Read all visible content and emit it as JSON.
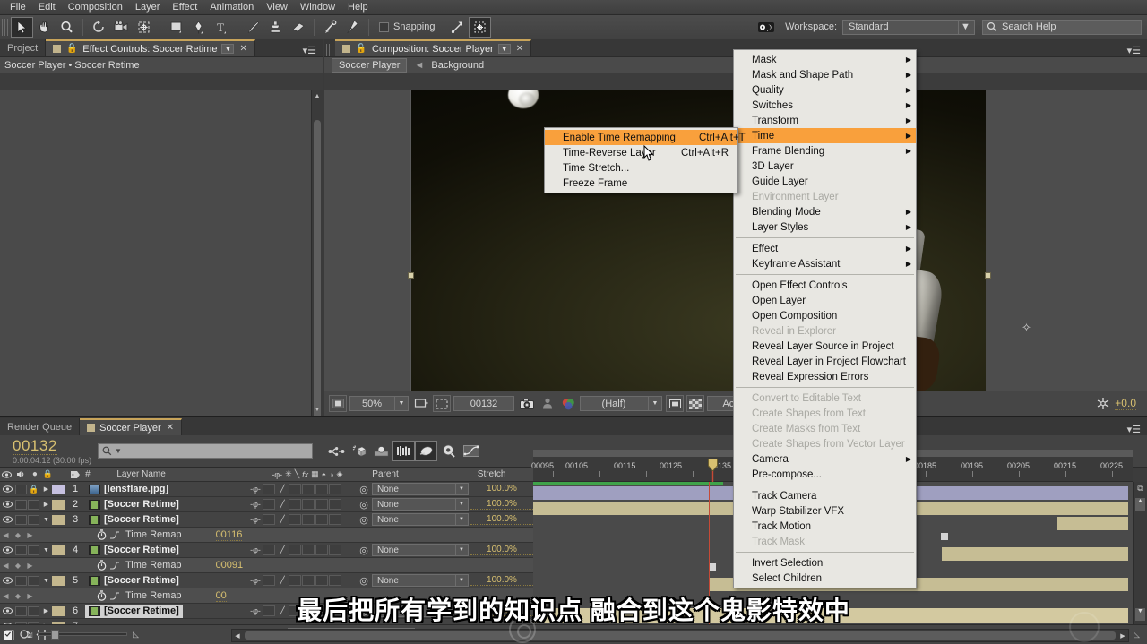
{
  "menubar": {
    "items": [
      "File",
      "Edit",
      "Composition",
      "Layer",
      "Effect",
      "Animation",
      "View",
      "Window",
      "Help"
    ]
  },
  "toolbar": {
    "tools": [
      "selection-tool",
      "hand-tool",
      "zoom-tool",
      "rotation-tool",
      "camera-tool",
      "pan-behind-tool",
      "shape-tool",
      "pen-tool",
      "text-tool",
      "brush-tool",
      "clone-stamp-tool",
      "eraser-tool",
      "roto-brush-tool",
      "puppet-tool"
    ],
    "snapping_label": "Snapping",
    "workspace_label": "Workspace:",
    "workspace_value": "Standard",
    "search_help_placeholder": "Search Help"
  },
  "left_panel": {
    "tabs": [
      {
        "label": "Project",
        "active": false
      },
      {
        "label": "Effect Controls: Soccer Retime",
        "active": true
      }
    ],
    "breadcrumb": "Soccer Player  •  Soccer Retime"
  },
  "comp_panel": {
    "tab_label": "Composition: Soccer Player",
    "nav_current": "Soccer Player",
    "nav_next": "Background",
    "toolbar": {
      "magnification": "50%",
      "current_time": "00132",
      "resolution": "(Half)",
      "view_mode": "Active Ca",
      "exposure": "+0.0"
    }
  },
  "timeline": {
    "tabs": [
      {
        "label": "Render Queue",
        "active": false
      },
      {
        "label": "Soccer Player",
        "active": true
      }
    ],
    "current_frame": "00132",
    "current_time_detail": "0:00:04:12 (30.00 fps)",
    "search_placeholder": "",
    "column_headers": [
      "#",
      "Layer Name",
      "Parent",
      "Stretch"
    ],
    "switch_header_icons": [
      "shy-icon",
      "quality-icon",
      "effects-icon",
      "frame-blend-icon",
      "motion-blur-icon",
      "adjustment-icon",
      "3d-layer-icon"
    ],
    "toggle_switches_label": "Toggle Switches / Modes",
    "ruler_ticks": [
      "00095",
      "00105",
      "00115",
      "00125",
      "00135",
      "00185",
      "00195",
      "00205",
      "00215",
      "00225"
    ],
    "layers": [
      {
        "index": "1",
        "name": "[lensflare.jpg]",
        "parent": "None",
        "stretch": "100.0%",
        "kind": "image",
        "expanded": false,
        "locked": true,
        "selected": false
      },
      {
        "index": "2",
        "name": "[Soccer Retime]",
        "parent": "None",
        "stretch": "100.0%",
        "kind": "comp",
        "expanded": false,
        "locked": false,
        "selected": false
      },
      {
        "index": "3",
        "name": "[Soccer Retime]",
        "parent": "None",
        "stretch": "100.0%",
        "kind": "comp",
        "expanded": true,
        "locked": false,
        "selected": false
      },
      {
        "index": "4",
        "name": "[Soccer Retime]",
        "parent": "None",
        "stretch": "100.0%",
        "kind": "comp",
        "expanded": true,
        "locked": false,
        "selected": false
      },
      {
        "index": "5",
        "name": "[Soccer Retime]",
        "parent": "None",
        "stretch": "100.0%",
        "kind": "comp",
        "expanded": true,
        "locked": false,
        "selected": false
      },
      {
        "index": "6",
        "name": "[Soccer Retime]",
        "parent": "None",
        "stretch": "100.0%",
        "kind": "comp",
        "expanded": false,
        "locked": false,
        "selected": true
      }
    ],
    "time_remap_rows": [
      {
        "label": "Time Remap",
        "value": "00116"
      },
      {
        "label": "Time Remap",
        "value": "00091"
      },
      {
        "label": "Time Remap",
        "value": "00"
      }
    ]
  },
  "context_menu": {
    "items": [
      {
        "label": "Mask",
        "submenu": true,
        "disabled": false,
        "selected": false
      },
      {
        "label": "Mask and Shape Path",
        "submenu": true,
        "disabled": false,
        "selected": false
      },
      {
        "label": "Quality",
        "submenu": true,
        "disabled": false,
        "selected": false
      },
      {
        "label": "Switches",
        "submenu": true,
        "disabled": false,
        "selected": false
      },
      {
        "label": "Transform",
        "submenu": true,
        "disabled": false,
        "selected": false
      },
      {
        "label": "Time",
        "submenu": true,
        "disabled": false,
        "selected": true
      },
      {
        "label": "Frame Blending",
        "submenu": true,
        "disabled": false,
        "selected": false
      },
      {
        "label": "3D Layer",
        "submenu": false,
        "disabled": false,
        "selected": false
      },
      {
        "label": "Guide Layer",
        "submenu": false,
        "disabled": false,
        "selected": false
      },
      {
        "label": "Environment Layer",
        "submenu": false,
        "disabled": true,
        "selected": false
      },
      {
        "label": "Blending Mode",
        "submenu": true,
        "disabled": false,
        "selected": false
      },
      {
        "label": "Layer Styles",
        "submenu": true,
        "disabled": false,
        "selected": false
      },
      {
        "separator": true
      },
      {
        "label": "Effect",
        "submenu": true,
        "disabled": false,
        "selected": false
      },
      {
        "label": "Keyframe Assistant",
        "submenu": true,
        "disabled": false,
        "selected": false
      },
      {
        "separator": true
      },
      {
        "label": "Open Effect Controls",
        "submenu": false,
        "disabled": false,
        "selected": false
      },
      {
        "label": "Open Layer",
        "submenu": false,
        "disabled": false,
        "selected": false
      },
      {
        "label": "Open Composition",
        "submenu": false,
        "disabled": false,
        "selected": false
      },
      {
        "label": "Reveal in Explorer",
        "submenu": false,
        "disabled": true,
        "selected": false
      },
      {
        "label": "Reveal Layer Source in Project",
        "submenu": false,
        "disabled": false,
        "selected": false
      },
      {
        "label": "Reveal Layer in Project Flowchart",
        "submenu": false,
        "disabled": false,
        "selected": false
      },
      {
        "label": "Reveal Expression Errors",
        "submenu": false,
        "disabled": false,
        "selected": false
      },
      {
        "separator": true
      },
      {
        "label": "Convert to Editable Text",
        "submenu": false,
        "disabled": true,
        "selected": false
      },
      {
        "label": "Create Shapes from Text",
        "submenu": false,
        "disabled": true,
        "selected": false
      },
      {
        "label": "Create Masks from Text",
        "submenu": false,
        "disabled": true,
        "selected": false
      },
      {
        "label": "Create Shapes from Vector Layer",
        "submenu": false,
        "disabled": true,
        "selected": false
      },
      {
        "label": "Camera",
        "submenu": true,
        "disabled": false,
        "selected": false
      },
      {
        "label": "Pre-compose...",
        "submenu": false,
        "disabled": false,
        "selected": false
      },
      {
        "separator": true
      },
      {
        "label": "Track Camera",
        "submenu": false,
        "disabled": false,
        "selected": false
      },
      {
        "label": "Warp Stabilizer VFX",
        "submenu": false,
        "disabled": false,
        "selected": false
      },
      {
        "label": "Track Motion",
        "submenu": false,
        "disabled": false,
        "selected": false
      },
      {
        "label": "Track Mask",
        "submenu": false,
        "disabled": true,
        "selected": false
      },
      {
        "separator": true
      },
      {
        "label": "Invert Selection",
        "submenu": false,
        "disabled": false,
        "selected": false
      },
      {
        "label": "Select Children",
        "submenu": false,
        "disabled": false,
        "selected": false
      }
    ]
  },
  "submenu": {
    "items": [
      {
        "label": "Enable Time Remapping",
        "shortcut": "Ctrl+Alt+T",
        "selected": true
      },
      {
        "label": "Time-Reverse Layer",
        "shortcut": "Ctrl+Alt+R",
        "selected": false
      },
      {
        "label": "Time Stretch...",
        "shortcut": "",
        "selected": false
      },
      {
        "label": "Freeze Frame",
        "shortcut": "",
        "selected": false
      }
    ]
  },
  "subtitle": {
    "text": "最后把所有学到的知识点 融合到这个鬼影特效中"
  },
  "colors": {
    "highlight": "#f9a03c",
    "accent_yellow": "#d8c070",
    "playhead": "#c64a36",
    "panel_bg": "#3c3c3c"
  }
}
